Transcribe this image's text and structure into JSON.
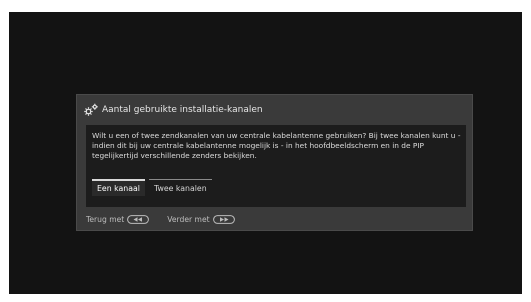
{
  "dialog": {
    "title": "Aantal gebruikte installatie-kanalen",
    "title_icon": "settings-gears-icon",
    "description": "Wilt u een of twee zendkanalen van uw centrale kabelantenne gebruiken? Bij twee kanalen kunt u - indien dit bij uw centrale kabelantenne mogelijk is - in het hoofdbeeldscherm en in de PIP tegelijkertijd verschillende zenders bekijken.",
    "options": [
      {
        "label": "Een kanaal",
        "selected": true
      },
      {
        "label": "Twee kanalen",
        "selected": false
      }
    ]
  },
  "footer": {
    "back_label": "Terug met",
    "back_key_icon": "rewind-key-icon",
    "next_label": "Verder met",
    "next_key_icon": "fast-forward-key-icon"
  },
  "colors": {
    "tv_background": "#131313",
    "dialog_background": "#3a3a3a",
    "content_background": "#1c1c1c",
    "selected_option": "#2a2a2a"
  }
}
